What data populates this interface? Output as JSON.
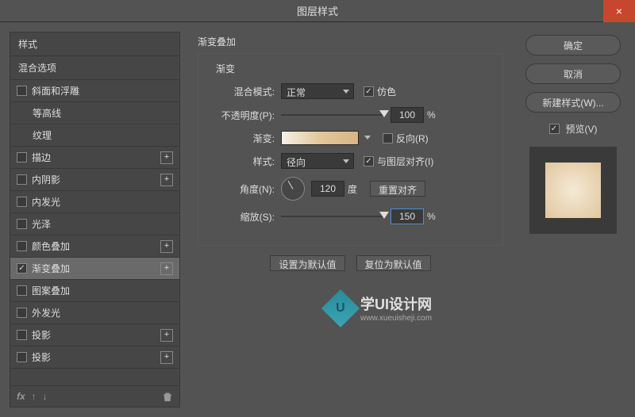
{
  "window": {
    "title": "图层样式",
    "close_icon": "×"
  },
  "left": {
    "header": "样式",
    "blend_options": "混合选项",
    "items": [
      {
        "label": "斜面和浮雕",
        "checked": false,
        "plus": false,
        "indent": false
      },
      {
        "label": "等高线",
        "checked": false,
        "plus": false,
        "indent": true
      },
      {
        "label": "纹理",
        "checked": false,
        "plus": false,
        "indent": true
      },
      {
        "label": "描边",
        "checked": false,
        "plus": true,
        "indent": false
      },
      {
        "label": "内阴影",
        "checked": false,
        "plus": true,
        "indent": false
      },
      {
        "label": "内发光",
        "checked": false,
        "plus": false,
        "indent": false
      },
      {
        "label": "光泽",
        "checked": false,
        "plus": false,
        "indent": false
      },
      {
        "label": "颜色叠加",
        "checked": false,
        "plus": true,
        "indent": false
      },
      {
        "label": "渐变叠加",
        "checked": true,
        "plus": true,
        "indent": false
      },
      {
        "label": "图案叠加",
        "checked": false,
        "plus": false,
        "indent": false
      },
      {
        "label": "外发光",
        "checked": false,
        "plus": false,
        "indent": false
      },
      {
        "label": "投影",
        "checked": false,
        "plus": true,
        "indent": false
      },
      {
        "label": "投影",
        "checked": false,
        "plus": true,
        "indent": false
      }
    ],
    "footer_fx": "fx"
  },
  "mid": {
    "section": "渐变叠加",
    "legend": "渐变",
    "blend_mode_label": "混合模式:",
    "blend_mode_value": "正常",
    "dither_label": "仿色",
    "opacity_label": "不透明度(P):",
    "opacity_value": "100",
    "percent": "%",
    "gradient_label": "渐变:",
    "reverse_label": "反向(R)",
    "style_label": "样式:",
    "style_value": "径向",
    "align_label": "与图层对齐(I)",
    "angle_label": "角度(N):",
    "angle_value": "120",
    "degree": "度",
    "reset_align": "重置对齐",
    "scale_label": "缩放(S):",
    "scale_value": "150",
    "set_default": "设置为默认值",
    "reset_default": "复位为默认值"
  },
  "right": {
    "ok": "确定",
    "cancel": "取消",
    "new_style": "新建样式(W)...",
    "preview_label": "预览(V)"
  },
  "watermark": {
    "logo_char": "U",
    "text1": "学UI设计网",
    "text2": "www.xueuisheji.com"
  }
}
